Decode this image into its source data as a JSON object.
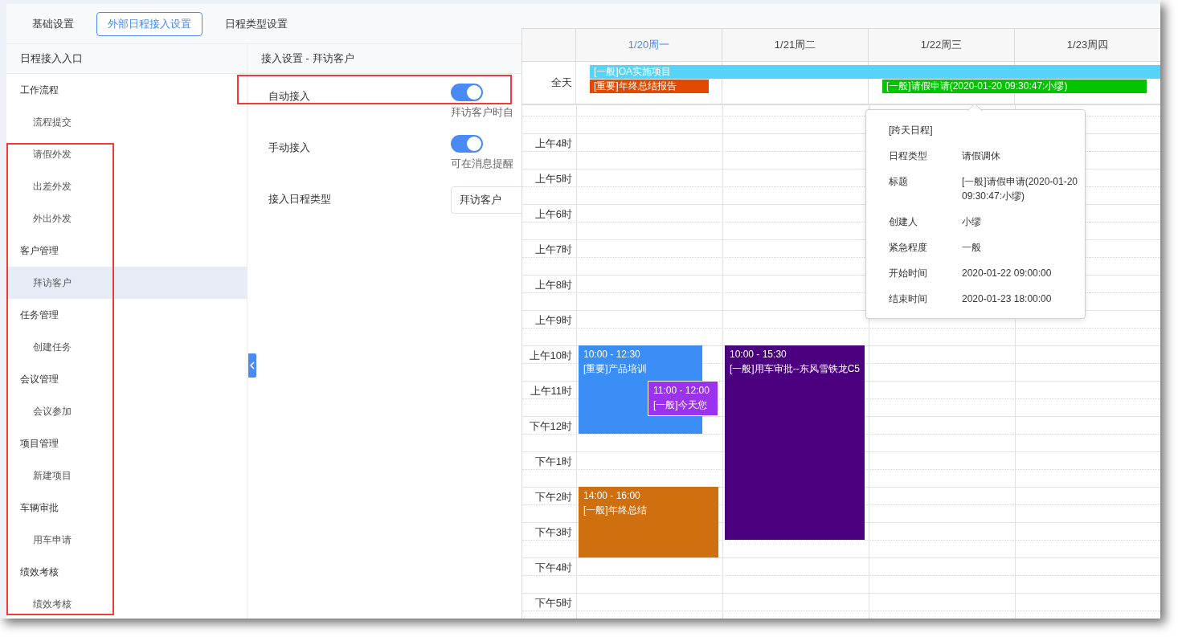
{
  "tabs": [
    {
      "label": "基础设置",
      "selected": false
    },
    {
      "label": "外部日程接入设置",
      "selected": true
    },
    {
      "label": "日程类型设置",
      "selected": false
    }
  ],
  "sidebar": {
    "header": "日程接入入口",
    "groups": [
      {
        "label": "工作流程",
        "children": [
          {
            "label": "流程提交",
            "selected": false
          },
          {
            "label": "请假外发",
            "selected": false
          },
          {
            "label": "出差外发",
            "selected": false
          },
          {
            "label": "外出外发",
            "selected": false
          }
        ]
      },
      {
        "label": "客户管理",
        "children": [
          {
            "label": "拜访客户",
            "selected": true
          }
        ]
      },
      {
        "label": "任务管理",
        "children": [
          {
            "label": "创建任务",
            "selected": false
          }
        ]
      },
      {
        "label": "会议管理",
        "children": [
          {
            "label": "会议参加",
            "selected": false
          }
        ]
      },
      {
        "label": "项目管理",
        "children": [
          {
            "label": "新建项目",
            "selected": false
          }
        ]
      },
      {
        "label": "车辆审批",
        "children": [
          {
            "label": "用车申请",
            "selected": false
          }
        ]
      },
      {
        "label": "绩效考核",
        "children": [
          {
            "label": "绩效考核",
            "selected": false
          }
        ]
      }
    ]
  },
  "settings": {
    "title": "接入设置 - 拜访客户",
    "rows": [
      {
        "kind": "toggle",
        "label": "自动接入",
        "on": true,
        "description": "拜访客户时自"
      },
      {
        "kind": "toggle",
        "label": "手动接入",
        "on": true,
        "description": "可在消息提醒"
      },
      {
        "kind": "select",
        "label": "接入日程类型",
        "value": "拜访客户"
      }
    ]
  },
  "calendar": {
    "days": [
      {
        "label": "1/20周一",
        "today": true,
        "events": [
          {
            "time": "10:00 - 12:30",
            "title": "[重要]产品培训",
            "color": "#3a8ef6",
            "kind": "left"
          },
          {
            "time": "11:00 - 12:00",
            "title": "[一般]今天您",
            "color": "#9b33ee",
            "kind": "right"
          },
          {
            "time": "14:00 - 16:00",
            "title": "[一般]年终总结",
            "color": "#d06f0f",
            "kind": "full"
          }
        ],
        "allday": [
          {
            "title": "[一般]OA实施项目",
            "color": "#55d3f8",
            "kind": "ongoing"
          },
          {
            "title": "[重要]年终总结报告",
            "color": "#e04a00",
            "kind": "one_day"
          }
        ]
      },
      {
        "label": "1/21周二",
        "today": false,
        "events": [
          {
            "time": "10:00 - 15:30",
            "title": "[一般]用车审批--东风雪铁龙C5",
            "color": "#4b0080",
            "kind": "full"
          }
        ]
      },
      {
        "label": "1/22周三",
        "today": false,
        "allday": [
          {
            "title": "[一般]请假申请(2020-01-20 09:30:47:小缪)",
            "color": "#00c400",
            "kind": "two_day"
          }
        ]
      },
      {
        "label": "1/23周四",
        "today": false
      }
    ],
    "allday_label": "全天",
    "hours": [
      "上午4时",
      "上午5时",
      "上午6时",
      "上午7时",
      "上午8时",
      "上午9时",
      "上午10时",
      "上午11时",
      "下午12时",
      "下午1时",
      "下午2时",
      "下午3时",
      "下午4时",
      "下午5时"
    ],
    "popover": {
      "heading": "[跨天日程]",
      "fields": [
        {
          "label": "日程类型",
          "value": "请假调休"
        },
        {
          "label": "标题",
          "value": "[一般]请假申请(2020-01-20 09:30:47:小缪)"
        },
        {
          "label": "创建人",
          "value": "小缪"
        },
        {
          "label": "紧急程度",
          "value": "一般"
        },
        {
          "label": "开始时间",
          "value": "2020-01-22 09:00:00"
        },
        {
          "label": "结束时间",
          "value": "2020-01-23 18:00:00"
        }
      ]
    }
  }
}
